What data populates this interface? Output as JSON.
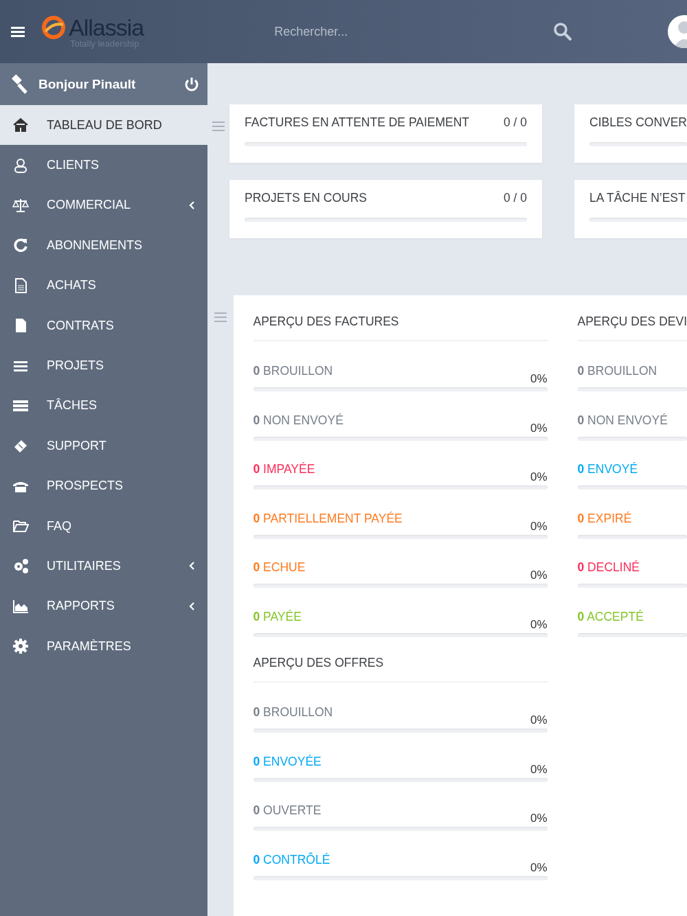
{
  "topbar": {
    "logo": {
      "name": "Allassia",
      "tagline": "Totally leadership"
    },
    "search": {
      "placeholder": "Rechercher..."
    }
  },
  "sidebar": {
    "greeting": "Bonjour Pinault",
    "items": [
      {
        "label": "TABLEAU DE BORD",
        "selected": true,
        "submenu": false
      },
      {
        "label": "CLIENTS",
        "selected": false,
        "submenu": false
      },
      {
        "label": "COMMERCIAL",
        "selected": false,
        "submenu": true
      },
      {
        "label": "ABONNEMENTS",
        "selected": false,
        "submenu": false
      },
      {
        "label": "ACHATS",
        "selected": false,
        "submenu": false
      },
      {
        "label": "CONTRATS",
        "selected": false,
        "submenu": false
      },
      {
        "label": "PROJETS",
        "selected": false,
        "submenu": false
      },
      {
        "label": "TÂCHES",
        "selected": false,
        "submenu": false
      },
      {
        "label": "SUPPORT",
        "selected": false,
        "submenu": false
      },
      {
        "label": "PROSPECTS",
        "selected": false,
        "submenu": false
      },
      {
        "label": "FAQ",
        "selected": false,
        "submenu": false
      },
      {
        "label": "UTILITAIRES",
        "selected": false,
        "submenu": true
      },
      {
        "label": "RAPPORTS",
        "selected": false,
        "submenu": true
      },
      {
        "label": "PARAMÈTRES",
        "selected": false,
        "submenu": false
      }
    ]
  },
  "stat_cards": [
    {
      "title": "FACTURES EN ATTENTE DE PAIEMENT",
      "value": "0 / 0",
      "level": 0
    },
    {
      "title": "CIBLES CONVER",
      "level": 0
    },
    {
      "title": "PROJETS EN COURS",
      "value": "0 / 0",
      "level": 0
    },
    {
      "title": "LA TÂCHE N’EST",
      "level": 0
    }
  ],
  "overview_columns": [
    [
      {
        "title": "APERÇU DES FACTURES",
        "rows": [
          {
            "count": "0",
            "label": "BROUILLON",
            "color": "#777e89",
            "percent": "0%",
            "level": 0
          },
          {
            "count": "0",
            "label": "NON ENVOYÉ",
            "color": "#777e89",
            "percent": "0%",
            "level": 0
          },
          {
            "count": "0",
            "label": "IMPAYÉE",
            "color": "#fc2d5a",
            "percent": "0%",
            "level": 0
          },
          {
            "count": "0",
            "label": "PARTIELLEMENT PAYÉE",
            "color": "#ff7a1f",
            "percent": "0%",
            "level": 0
          },
          {
            "count": "0",
            "label": "ECHUE",
            "color": "#ff7a1f",
            "percent": "0%",
            "level": 0
          },
          {
            "count": "0",
            "label": "PAYÉE",
            "color": "#84c529",
            "percent": "0%",
            "level": 0
          }
        ]
      },
      {
        "title": "APERÇU DES OFFRES",
        "rows": [
          {
            "count": "0",
            "label": "BROUILLON",
            "color": "#777e89",
            "percent": "0%",
            "level": 0
          },
          {
            "count": "0",
            "label": "ENVOYÉE",
            "color": "#03a9f4",
            "percent": "0%",
            "level": 0
          },
          {
            "count": "0",
            "label": "OUVERTE",
            "color": "#777e89",
            "percent": "0%",
            "level": 0
          },
          {
            "count": "0",
            "label": "CONTRÔLÉ",
            "color": "#03a9f4",
            "percent": "0%",
            "level": 0
          }
        ]
      }
    ],
    [
      {
        "title": "APERÇU DES DEVI",
        "rows": [
          {
            "count": "0",
            "label": "BROUILLON",
            "color": "#777e89",
            "level": 0
          },
          {
            "count": "0",
            "label": "NON ENVOYÉ",
            "color": "#777e89",
            "level": 0
          },
          {
            "count": "0",
            "label": "ENVOYÉ",
            "color": "#03a9f4",
            "level": 0
          },
          {
            "count": "0",
            "label": "EXPIRÉ",
            "color": "#ff7a1f",
            "level": 0
          },
          {
            "count": "0",
            "label": "DECLINÉ",
            "color": "#fc2d5a",
            "level": 0
          },
          {
            "count": "0",
            "label": "ACCEPTÉ",
            "color": "#84c529",
            "level": 0
          }
        ]
      }
    ]
  ]
}
